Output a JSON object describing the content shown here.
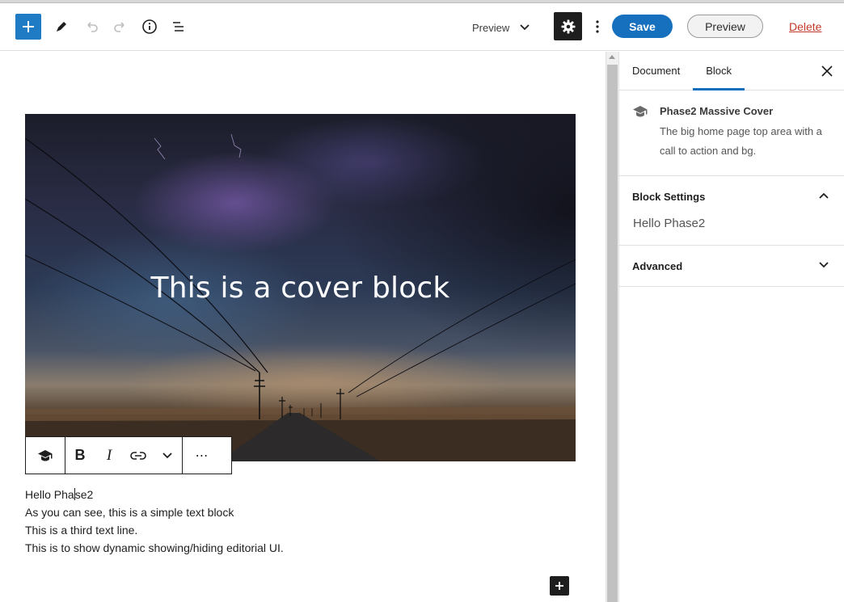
{
  "header": {
    "preview_dropdown_label": "Preview",
    "save_label": "Save",
    "preview_button_label": "Preview",
    "delete_label": "Delete"
  },
  "cover": {
    "title": "This is a cover block"
  },
  "block_toolbar": {
    "bold_label": "B",
    "italic_label": "I",
    "more_label": "⋯"
  },
  "paragraphs": {
    "line1_before_caret": "Hello Pha",
    "line1_after_caret": "se2",
    "line2": "As you can see, this is a simple text block",
    "line3": "This is a third text line.",
    "line4": "This is to show dynamic showing/hiding editorial UI."
  },
  "sidebar": {
    "tabs": [
      "Document",
      "Block"
    ],
    "active_tab": "Block",
    "block_card": {
      "title": "Phase2 Massive Cover",
      "description": "The big home page top area with a call to action and bg."
    },
    "block_settings": {
      "title": "Block Settings",
      "value": "Hello Phase2",
      "expanded": true
    },
    "advanced": {
      "title": "Advanced",
      "expanded": false
    }
  },
  "colors": {
    "accent": "#1770be",
    "inserter": "#1e7bc4",
    "delete": "#c0392b",
    "dark": "#1e1e1e"
  },
  "icons": {
    "inserter": "plus-icon",
    "tools": "pencil-icon",
    "undo": "undo-icon",
    "redo": "redo-icon",
    "info": "info-icon",
    "outline": "list-view-icon",
    "settings": "gear-icon",
    "options": "kebab-icon",
    "block_type": "graduation-cap-icon",
    "link": "link-icon"
  }
}
